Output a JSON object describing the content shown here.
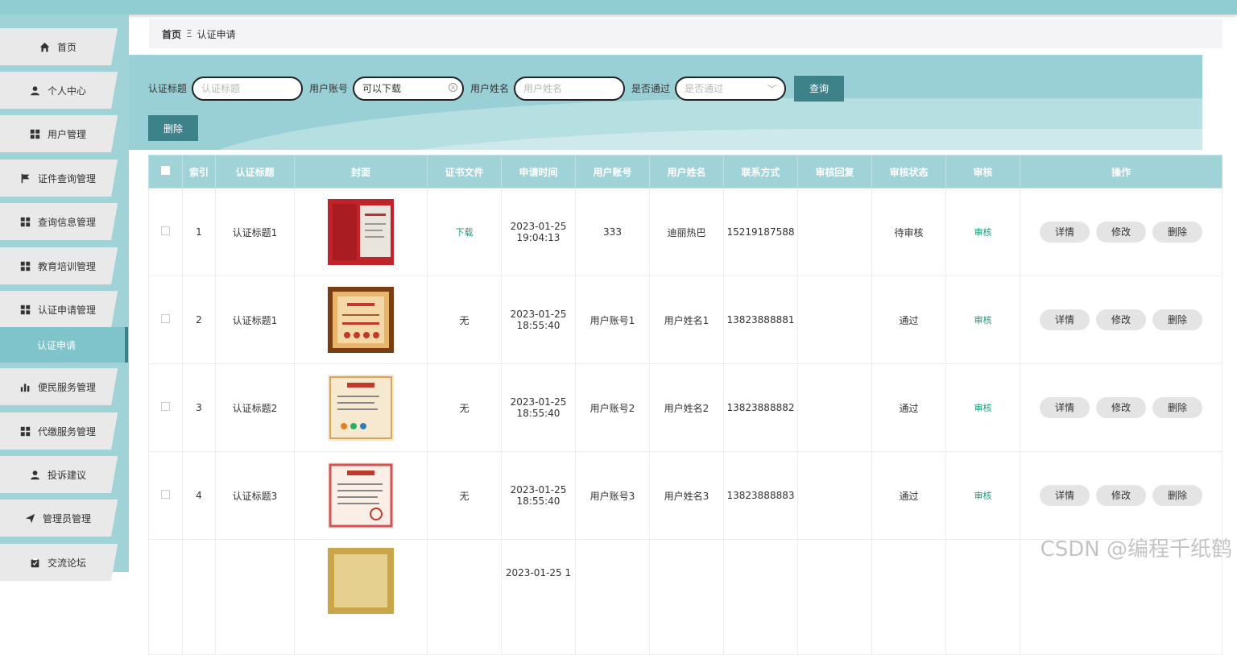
{
  "sidebar": {
    "items": [
      {
        "label": "首页",
        "icon": "home-icon"
      },
      {
        "label": "个人中心",
        "icon": "user-icon"
      },
      {
        "label": "用户管理",
        "icon": "grid-icon"
      },
      {
        "label": "证件查询管理",
        "icon": "flag-icon"
      },
      {
        "label": "查询信息管理",
        "icon": "grid-icon"
      },
      {
        "label": "教育培训管理",
        "icon": "grid-icon"
      },
      {
        "label": "认证申请管理",
        "icon": "grid-icon"
      },
      {
        "label": "便民服务管理",
        "icon": "bar-chart-icon"
      },
      {
        "label": "代缴服务管理",
        "icon": "grid-icon"
      },
      {
        "label": "投诉建议",
        "icon": "user-icon"
      },
      {
        "label": "管理员管理",
        "icon": "send-icon"
      },
      {
        "label": "交流论坛",
        "icon": "clipboard-icon"
      }
    ],
    "active_sub": "认证申请"
  },
  "breadcrumb": {
    "home": "首页",
    "separator": "Ξ",
    "current": "认证申请"
  },
  "search": {
    "title_label": "认证标题",
    "title_placeholder": "认证标题",
    "account_label": "用户账号",
    "account_value": "可以下载",
    "name_label": "用户姓名",
    "name_placeholder": "用户姓名",
    "passed_label": "是否通过",
    "passed_placeholder": "是否通过",
    "query_button": "查询"
  },
  "actions": {
    "batch_delete": "删除"
  },
  "table": {
    "headers": [
      "索引",
      "认证标题",
      "封面",
      "证书文件",
      "申请时间",
      "用户账号",
      "用户姓名",
      "联系方式",
      "审核回复",
      "审核状态",
      "审核",
      "操作"
    ],
    "rows": [
      {
        "index": "1",
        "title": "认证标题1",
        "file": "下载",
        "time": "2023-01-25 19:04:13",
        "account": "333",
        "name": "迪丽热巴",
        "phone": "15219187588",
        "reply": "",
        "status": "待审核",
        "audit": "审核"
      },
      {
        "index": "2",
        "title": "认证标题1",
        "file": "无",
        "time": "2023-01-25 18:55:40",
        "account": "用户账号1",
        "name": "用户姓名1",
        "phone": "13823888881",
        "reply": "",
        "status": "通过",
        "audit": "审核"
      },
      {
        "index": "3",
        "title": "认证标题2",
        "file": "无",
        "time": "2023-01-25 18:55:40",
        "account": "用户账号2",
        "name": "用户姓名2",
        "phone": "13823888882",
        "reply": "",
        "status": "通过",
        "audit": "审核"
      },
      {
        "index": "4",
        "title": "认证标题3",
        "file": "无",
        "time": "2023-01-25 18:55:40",
        "account": "用户账号3",
        "name": "用户姓名3",
        "phone": "13823888883",
        "reply": "",
        "status": "通过",
        "audit": "审核"
      },
      {
        "index": "",
        "title": "",
        "file": "",
        "time": "2023-01-25 1",
        "account": "",
        "name": "",
        "phone": "",
        "reply": "",
        "status": "",
        "audit": ""
      }
    ],
    "row_buttons": {
      "detail": "详情",
      "edit": "修改",
      "delete": "删除"
    }
  },
  "watermark": "CSDN @编程千纸鹤",
  "colors": {
    "accent": "#3d8189",
    "sidebar": "#9fd3d8",
    "header_bg": "#9fd3d8",
    "link": "#1a9c7a"
  }
}
